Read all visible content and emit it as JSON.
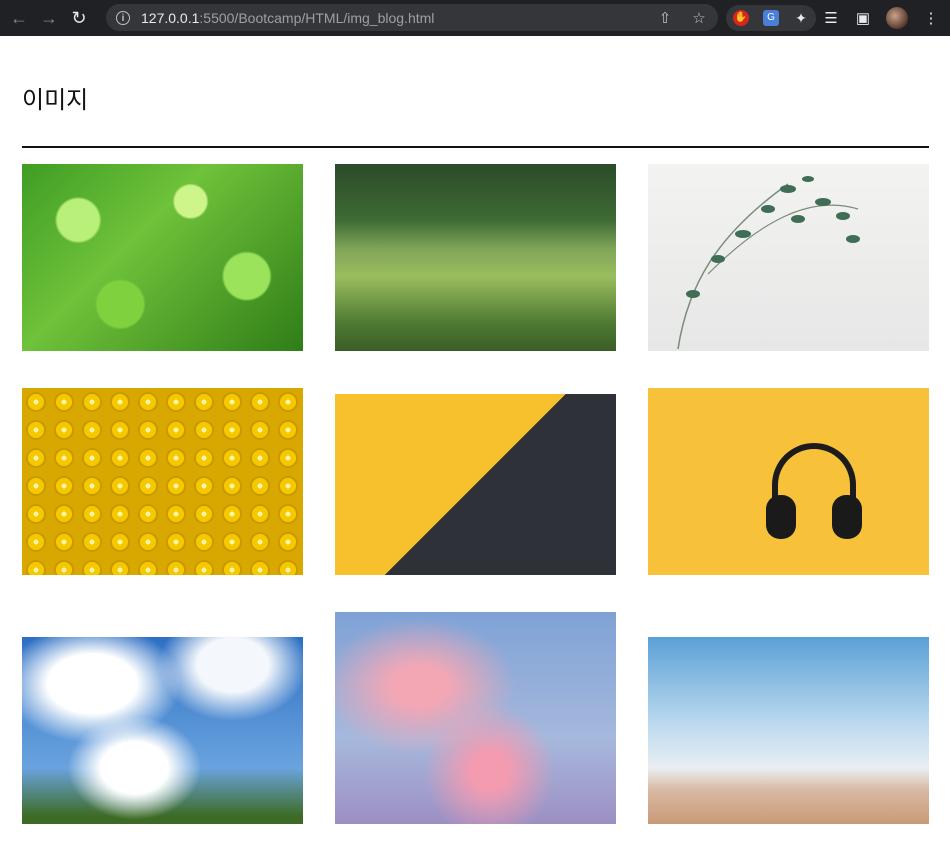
{
  "browser": {
    "url_host": "127.0.0.1",
    "url_rest": ":5500/Bootcamp/HTML/img_blog.html"
  },
  "page": {
    "title": "이미지"
  },
  "gallery": [
    {
      "icon": "leaves-image"
    },
    {
      "icon": "mountain-road-image"
    },
    {
      "icon": "plant-vase-image"
    },
    {
      "icon": "yellow-balls-image"
    },
    {
      "icon": "yellow-bricks-image"
    },
    {
      "icon": "headphones-image"
    },
    {
      "icon": "blue-sky-clouds-image"
    },
    {
      "icon": "pink-sky-image"
    },
    {
      "icon": "beach-sky-image"
    }
  ]
}
